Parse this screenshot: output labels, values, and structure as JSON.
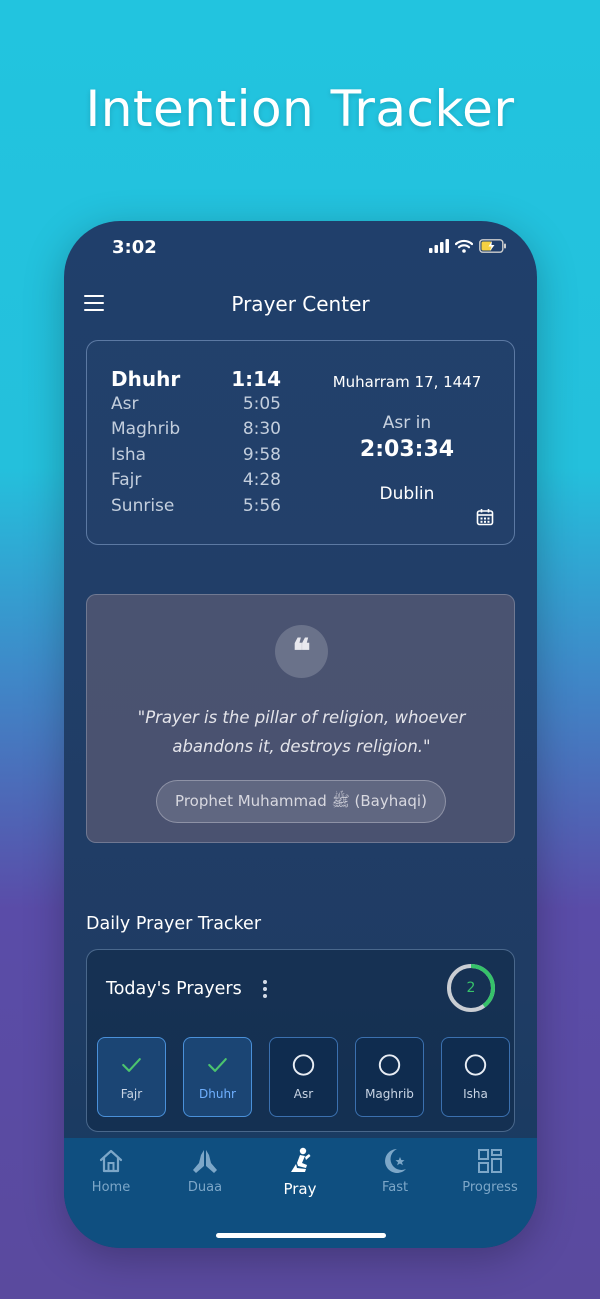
{
  "promo": {
    "title": "Intention Tracker"
  },
  "status_bar": {
    "time": "3:02"
  },
  "header": {
    "title": "Prayer Center"
  },
  "prayer_times": {
    "current": {
      "name": "Dhuhr",
      "time": "1:14"
    },
    "list": [
      {
        "name": "Asr",
        "time": "5:05"
      },
      {
        "name": "Maghrib",
        "time": "8:30"
      },
      {
        "name": "Isha",
        "time": "9:58"
      },
      {
        "name": "Fajr",
        "time": "4:28"
      },
      {
        "name": "Sunrise",
        "time": "5:56"
      }
    ],
    "hijri_date": "Muharram 17, 1447",
    "next_label": "Asr in",
    "countdown": "2:03:34",
    "city": "Dublin"
  },
  "quote": {
    "text": "\"Prayer is the pillar of religion, whoever abandons it, destroys religion.\"",
    "source": "Prophet Muhammad ﷺ (Bayhaqi)"
  },
  "tracker": {
    "section_title": "Daily Prayer Tracker",
    "card_title": "Today's Prayers",
    "completed_count": "2",
    "completed_fraction": 0.4,
    "prayers": [
      {
        "label": "Fajr",
        "done": true
      },
      {
        "label": "Dhuhr",
        "done": true
      },
      {
        "label": "Asr",
        "done": false
      },
      {
        "label": "Maghrib",
        "done": false
      },
      {
        "label": "Isha",
        "done": false
      }
    ]
  },
  "bottom_nav": {
    "items": [
      {
        "label": "Home",
        "icon": "home-icon"
      },
      {
        "label": "Duaa",
        "icon": "praying-hands-icon"
      },
      {
        "label": "Pray",
        "icon": "person-praying-icon",
        "active": true
      },
      {
        "label": "Fast",
        "icon": "crescent-star-icon"
      },
      {
        "label": "Progress",
        "icon": "grid-icon"
      }
    ]
  },
  "colors": {
    "accent_green": "#36c26a",
    "accent_blue": "#6fb0ff",
    "nav_background": "#0f4f80"
  }
}
